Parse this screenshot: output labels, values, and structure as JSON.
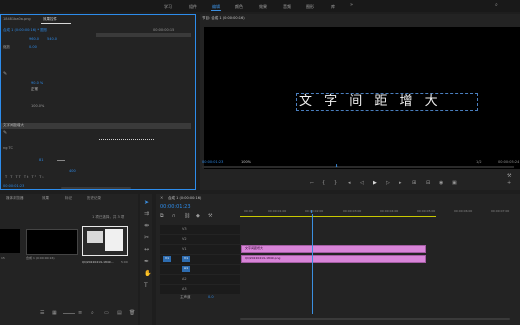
{
  "topbar": {
    "items": [
      "学习",
      "组件",
      "编辑",
      "颜色",
      "效果",
      "音频",
      "图形",
      "库"
    ],
    "active_index": 2
  },
  "effect_controls": {
    "tabs": [
      "源: (无剪辑)",
      "效果控件"
    ],
    "source_label": "18481ba0a.png",
    "sequence_label": "合成 1 (0:00:00:16) * 图形",
    "tc_right": "00:00:00:15",
    "rows": {
      "pos_value_1": "960.0",
      "pos_value_2": "540.0",
      "scale_label": "缩放",
      "scale_value": "0.00",
      "opacity_value": "90.0 %",
      "blend_label": "正常",
      "pct_value": "100.0%",
      "text_layer": "文字间距增大",
      "font_label": "ng TC",
      "font_size": "81",
      "tracking": "400",
      "style_chars": "T T TT Tt T¹ T₁"
    },
    "current_time": "00:00:01:23"
  },
  "program": {
    "title": "节目: 合成 1 (0:00:00:16)",
    "caption": "文 字 间 距 增 大",
    "timecode": "00:00:01:23",
    "zoom": "100%",
    "scale": "1/2",
    "duration": "00:00:05:24"
  },
  "project": {
    "tabs": [
      "媒体浏览器",
      "效果",
      "标记",
      "历史记录"
    ],
    "status": "1 项已选择，共 3 项",
    "item1_name": "合成 1 (0:00:00:16)",
    "item2_name": "QQ20220419-1849...",
    "item2_dur": "5:00",
    "item0_dur": "15"
  },
  "timeline": {
    "title": "合成 1 (0:00:00:16)",
    "timecode": "00:00:01:23",
    "ruler": [
      "00:00",
      "00:00:01:00",
      "00:00:02:00",
      "00:00:03:00",
      "00:00:04:00",
      "00:00:05:00",
      "00:00:06:00",
      "00:00:07:00"
    ],
    "tracks": {
      "v3": "V3",
      "v2": "V2",
      "v1": "V1",
      "a1": "A1",
      "a2": "A2",
      "a3": "A3",
      "master": "主声道",
      "master_val": "0.0"
    },
    "clip_text": "文字间距增大",
    "clip_image": "QQ20220419-1849.png",
    "src_v1": "V1",
    "src_a1": "A1"
  },
  "colors": {
    "accent": "#2d8ceb",
    "clip": "#d884d8",
    "playhead": "#3b8fe0"
  }
}
